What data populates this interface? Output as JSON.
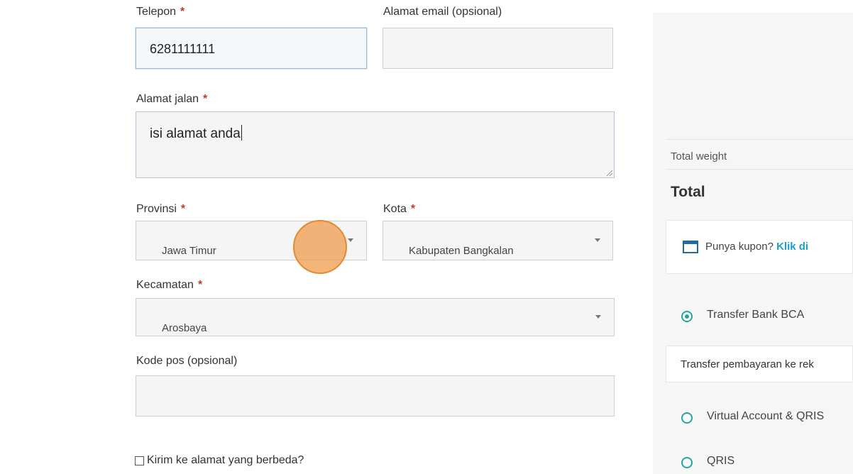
{
  "form": {
    "telepon": {
      "label": "Telepon",
      "value": "6281111111"
    },
    "email": {
      "label": "Alamat email (opsional)",
      "value": ""
    },
    "alamat": {
      "label": "Alamat jalan",
      "value": "isi alamat anda"
    },
    "provinsi": {
      "label": "Provinsi",
      "value": "Jawa Timur"
    },
    "kota": {
      "label": "Kota",
      "value": "Kabupaten Bangkalan"
    },
    "kecamatan": {
      "label": "Kecamatan",
      "value": "Arosbaya"
    },
    "kodepos": {
      "label": "Kode pos (opsional)",
      "value": ""
    },
    "ship_different": {
      "label": "Kirim ke alamat yang berbeda?",
      "checked": false
    },
    "required_mark": "*"
  },
  "sidebar": {
    "total_weight_label": "Total weight",
    "total_label": "Total",
    "coupon_text": "Punya kupon?",
    "coupon_link": "Klik di",
    "payment_methods": [
      {
        "label": "Transfer Bank BCA",
        "selected": true
      },
      {
        "label": "Virtual Account & QRIS",
        "selected": false
      },
      {
        "label": "QRIS",
        "selected": false
      }
    ],
    "bca_description": "Transfer pembayaran ke rek"
  },
  "colors": {
    "accent": "#26a69a",
    "link": "#1aa0c9",
    "required": "#c0392b",
    "cursor_highlight": "#f09848"
  },
  "icons": {
    "coupon": "calendar-icon",
    "select": "chevron-down-icon"
  }
}
